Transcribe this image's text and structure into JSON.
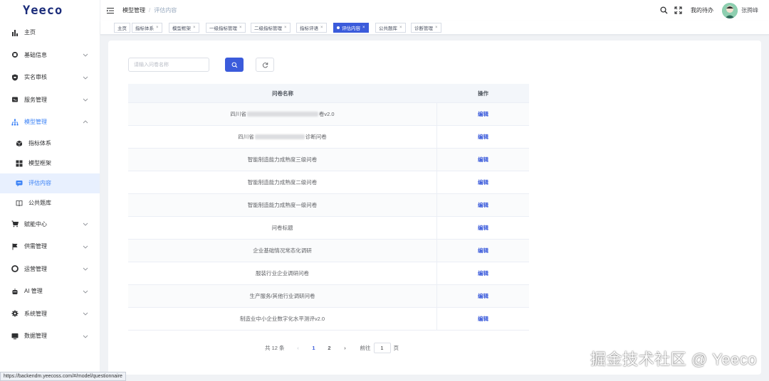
{
  "app": {
    "logo": "Yeeco"
  },
  "sidebar": {
    "items": [
      {
        "label": "主页",
        "icon": "bar-chart-icon"
      },
      {
        "label": "基础信息",
        "icon": "building-icon",
        "has_children": true
      },
      {
        "label": "实名审核",
        "icon": "shield-icon",
        "has_children": true
      },
      {
        "label": "服务管理",
        "icon": "tray-icon",
        "has_children": true
      },
      {
        "label": "模型管理",
        "icon": "hierarchy-icon",
        "has_children": true,
        "open": true,
        "children": [
          {
            "label": "指标体系",
            "icon": "cube-icon"
          },
          {
            "label": "模型框架",
            "icon": "grid-icon"
          },
          {
            "label": "评估内容",
            "icon": "message-icon",
            "active": true
          },
          {
            "label": "公共题库",
            "icon": "book-icon"
          }
        ]
      },
      {
        "label": "赋能中心",
        "icon": "cart-icon",
        "has_children": true
      },
      {
        "label": "供需管理",
        "icon": "flag-icon",
        "has_children": true
      },
      {
        "label": "运营管理",
        "icon": "lifebuoy-icon",
        "has_children": true
      },
      {
        "label": "AI 管理",
        "icon": "robot-icon",
        "has_children": true
      },
      {
        "label": "系统管理",
        "icon": "gear-icon",
        "has_children": true
      },
      {
        "label": "数据管理",
        "icon": "monitor-icon",
        "has_children": true
      }
    ]
  },
  "header": {
    "breadcrumb": [
      "模型管理",
      "评估内容"
    ],
    "todo": "我的待办",
    "username": "张腾峰"
  },
  "tags": [
    {
      "label": "主页",
      "closable": false
    },
    {
      "label": "指标体系",
      "closable": true
    },
    {
      "label": "模型框架",
      "closable": true
    },
    {
      "label": "一级指标管理",
      "closable": true
    },
    {
      "label": "二级指标管理",
      "closable": true
    },
    {
      "label": "指标评语",
      "closable": true
    },
    {
      "label": "评估内容",
      "closable": true,
      "active": true
    },
    {
      "label": "公共题库",
      "closable": true
    },
    {
      "label": "诊断管理",
      "closable": true
    }
  ],
  "search": {
    "placeholder": "请输入问卷名称",
    "value": ""
  },
  "table": {
    "headers": [
      "问卷名称",
      "操作"
    ],
    "action_label": "编辑",
    "rows": [
      {
        "pre": "四川省",
        "post": "卷v2.0",
        "redacted": true
      },
      {
        "pre": "四川省",
        "post": "诊断问卷",
        "redacted": true
      },
      {
        "name": "智能制造能力成熟度三级问卷"
      },
      {
        "name": "智能制造能力成熟度二级问卷"
      },
      {
        "name": "智能制造能力成熟度一级问卷"
      },
      {
        "name": "问卷标题"
      },
      {
        "name": "企业基础情况常态化调研"
      },
      {
        "name": "服装行业企业调研问卷"
      },
      {
        "name": "生产服务/其他行业调研问卷"
      },
      {
        "name": "制造业中小企业数字化水平测评v2.0"
      }
    ]
  },
  "pagination": {
    "total": "共 12 条",
    "pages": [
      "1",
      "2"
    ],
    "current_page": "1",
    "goto_label": "前往",
    "goto_value": "1",
    "page_suffix": "页"
  },
  "statusbar": {
    "url": "https://backendm.yeecoss.com/#/model/questionnaire"
  },
  "watermark": "掘金技术社区 @ Yeeco",
  "colors": {
    "primary": "#3b5bdb",
    "sidebar_active_bg": "#e8f0fe",
    "sidebar_active_text": "#3b82f6"
  }
}
